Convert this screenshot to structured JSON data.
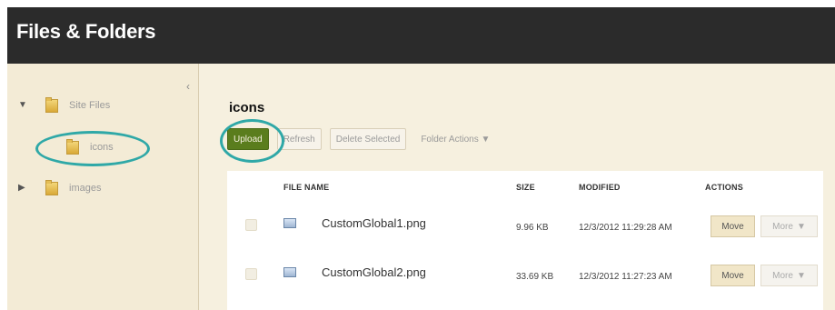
{
  "window": {
    "title": "Files & Folders"
  },
  "sidebar": {
    "collapse_glyph": "‹",
    "tree": [
      {
        "toggle": "▼",
        "label": "Site Files",
        "icon": "folder-icon"
      },
      {
        "toggle": "",
        "label": "icons",
        "icon": "folder-icon",
        "selected": true
      },
      {
        "toggle": "▶",
        "label": "images",
        "icon": "folder-icon"
      }
    ]
  },
  "main": {
    "folder_title": "icons",
    "toolbar": {
      "upload": "Upload",
      "refresh": "Refresh",
      "delete_selected": "Delete Selected",
      "folder_actions": "Folder Actions ▼"
    },
    "table": {
      "columns": [
        "FILE NAME",
        "SIZE",
        "MODIFIED",
        "ACTIONS"
      ],
      "rows": [
        {
          "name": "CustomGlobal1.png",
          "size": "9.96 KB",
          "modified": "12/3/2012 11:29:28 AM",
          "move": "Move",
          "more": "More",
          "more_arrow": "▼"
        },
        {
          "name": "CustomGlobal2.png",
          "size": "33.69 KB",
          "modified": "12/3/2012 11:27:23 AM",
          "move": "Move",
          "more": "More",
          "more_arrow": "▼"
        }
      ]
    }
  },
  "colors": {
    "highlight_circle": "#2fa8a7",
    "upload_button": "#5a7d1d",
    "titlebar": "#2b2b2b",
    "panel_background": "#f6f0df"
  }
}
